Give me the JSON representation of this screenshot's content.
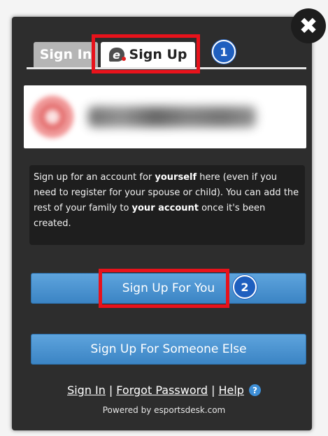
{
  "dialog": {
    "close_glyph": "✖",
    "tabs": [
      {
        "label": "Sign In",
        "active": false
      },
      {
        "label": "Sign Up",
        "active": true,
        "icon": "esportsdesk-e-icon",
        "icon_glyph": "e"
      }
    ],
    "steps": [
      "1",
      "2"
    ],
    "info_text": {
      "part1": "Sign up for an account for ",
      "bold1": "yourself",
      "part2": " here (even if you need to register for your spouse or child). You can add the rest of your family to ",
      "bold2": "your account",
      "part3": " once it's been created."
    },
    "buttons": {
      "sign_up_you": "Sign Up For You",
      "sign_up_else": "Sign Up For Someone Else"
    },
    "footer": {
      "sign_in": "Sign In",
      "sep1": "|",
      "forgot": "Forgot Password",
      "sep2": "|",
      "help": "Help",
      "help_glyph": "?",
      "powered": "Powered by esportsdesk.com"
    },
    "colors": {
      "modal_bg": "#2d2d2d",
      "highlight": "#e8121b",
      "badge": "#1f5fbf",
      "button": "#4a93d2"
    }
  }
}
